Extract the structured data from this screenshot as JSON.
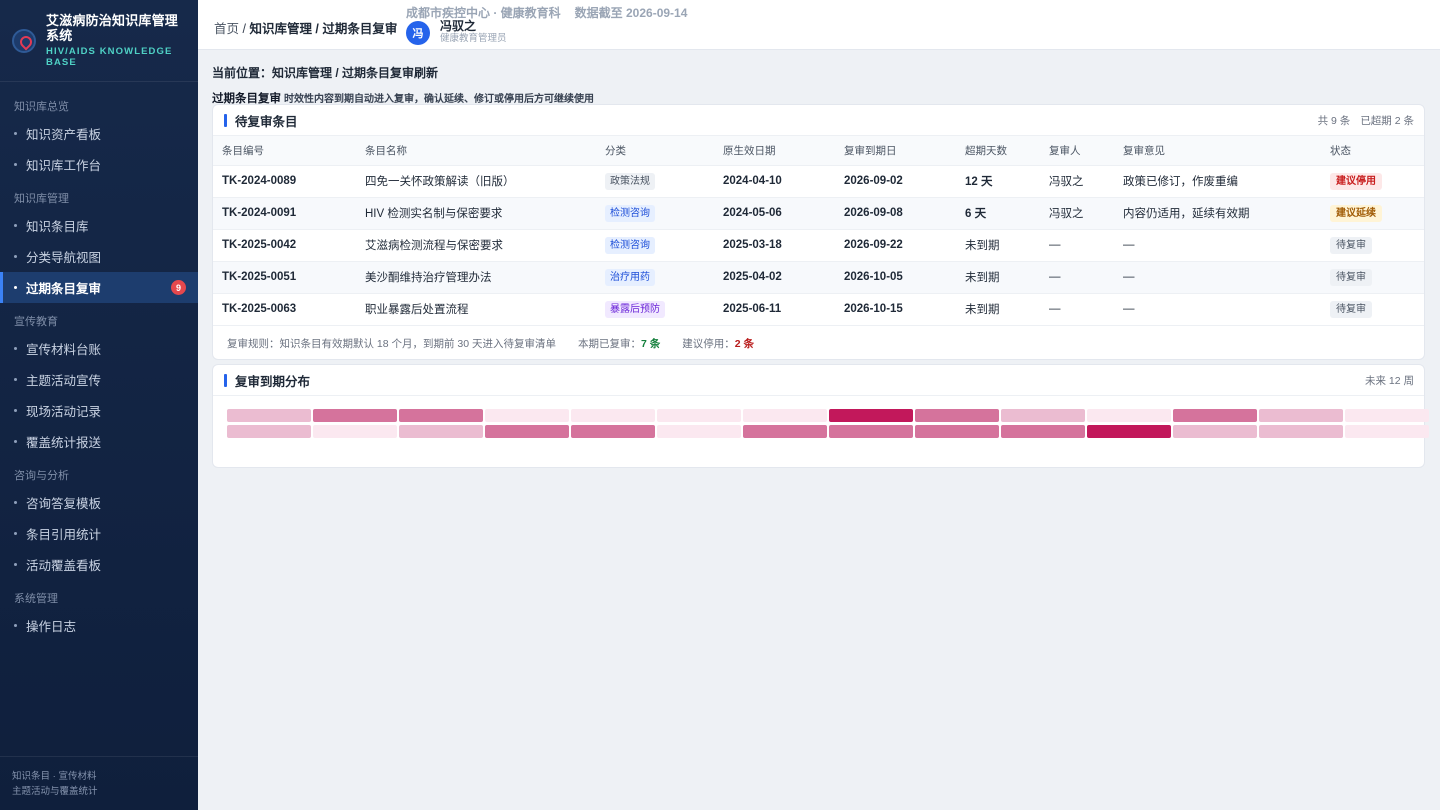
{
  "brand": {
    "title": "艾滋病防治知识库管理系统",
    "subtitle": "HIV/AIDS KNOWLEDGE BASE"
  },
  "sidebar": {
    "groups": [
      {
        "label": "知识库总览",
        "items": [
          "知识资产看板",
          "知识库工作台"
        ]
      },
      {
        "label": "知识库管理",
        "items": [
          "知识条目库",
          "分类导航视图",
          "过期条目复审"
        ]
      },
      {
        "label": "宣传教育",
        "items": [
          "宣传材料台账",
          "主题活动宣传",
          "现场活动记录",
          "覆盖统计报送"
        ]
      },
      {
        "label": "咨询与分析",
        "items": [
          "咨询答复模板",
          "条目引用统计",
          "活动覆盖看板"
        ]
      },
      {
        "label": "系统管理",
        "items": [
          "操作日志"
        ]
      }
    ],
    "active_badge": "9",
    "footer_line1": "知识条目 · 宣传材料",
    "footer_line2": "主题活动与覆盖统计"
  },
  "header": {
    "crumb_home": "首页",
    "crumb_sep": " / ",
    "crumb_current": "知识库管理 / 过期条目复审",
    "org": "成都市疾控中心 · 健康教育科",
    "data_date": "数据截至 2026-09-14",
    "user_initial": "冯",
    "user_name": "冯驭之",
    "user_role": "健康教育管理员"
  },
  "location": "当前位置：知识库管理 / 过期条目复审刷新",
  "section": {
    "title": "过期条目复审",
    "desc": "时效性内容到期自动进入复审，确认延续、修订或停用后方可继续使用"
  },
  "review_card": {
    "title": "待复审条目",
    "total": "共 9 条",
    "overdue": "已超期 2 条",
    "columns": [
      "条目编号",
      "条目名称",
      "分类",
      "原生效日期",
      "复审到期日",
      "超期天数",
      "复审人",
      "复审意见",
      "状态"
    ],
    "rows": [
      {
        "id": "TK-2024-0089",
        "name": "四免一关怀政策解读（旧版）",
        "category": "政策法规",
        "cat_class": "tag-policy",
        "start": "2024-04-10",
        "due": "2026-09-02",
        "overdue": "12 天",
        "reviewer": "冯驭之",
        "opinion": "政策已修订，作废重编",
        "status": "建议停用",
        "st_class": "st-stop"
      },
      {
        "id": "TK-2024-0091",
        "name": "HIV 检测实名制与保密要求",
        "category": "检测咨询",
        "cat_class": "tag-test",
        "start": "2024-05-06",
        "due": "2026-09-08",
        "overdue": "6 天",
        "reviewer": "冯驭之",
        "opinion": "内容仍适用，延续有效期",
        "status": "建议延续",
        "st_class": "st-ext"
      },
      {
        "id": "TK-2025-0042",
        "name": "艾滋病检测流程与保密要求",
        "category": "检测咨询",
        "cat_class": "tag-test",
        "start": "2025-03-18",
        "due": "2026-09-22",
        "overdue": "未到期",
        "reviewer": "—",
        "opinion": "—",
        "status": "待复审",
        "st_class": "st-wait"
      },
      {
        "id": "TK-2025-0051",
        "name": "美沙酮维持治疗管理办法",
        "category": "治疗用药",
        "cat_class": "tag-treat",
        "start": "2025-04-02",
        "due": "2026-10-05",
        "overdue": "未到期",
        "reviewer": "—",
        "opinion": "—",
        "status": "待复审",
        "st_class": "st-wait"
      },
      {
        "id": "TK-2025-0063",
        "name": "职业暴露后处置流程",
        "category": "暴露后预防",
        "cat_class": "tag-expo",
        "start": "2025-06-11",
        "due": "2026-10-15",
        "overdue": "未到期",
        "reviewer": "—",
        "opinion": "—",
        "status": "待复审",
        "st_class": "st-wait"
      }
    ],
    "rule": "复审规则：知识条目有效期默认 18 个月，到期前 30 天进入待复审清单",
    "reviewed_label": "本期已复审：",
    "reviewed_value": "7 条",
    "stop_label": "建议停用：",
    "stop_value": "2 条"
  },
  "dist_card": {
    "title": "复审到期分布",
    "meta": "未来 12 周",
    "levels": [
      [
        1,
        2,
        2,
        0,
        0,
        0,
        0,
        3,
        2,
        1,
        0,
        2,
        1,
        0
      ],
      [
        1,
        0,
        1,
        2,
        2,
        0,
        2,
        2,
        2,
        2,
        3,
        1,
        1,
        0
      ]
    ],
    "colors": {
      "level0": "#fbe8f0",
      "level1": "#ebbcd1",
      "level2": "#d5739c",
      "level3": "#c2185b"
    }
  }
}
